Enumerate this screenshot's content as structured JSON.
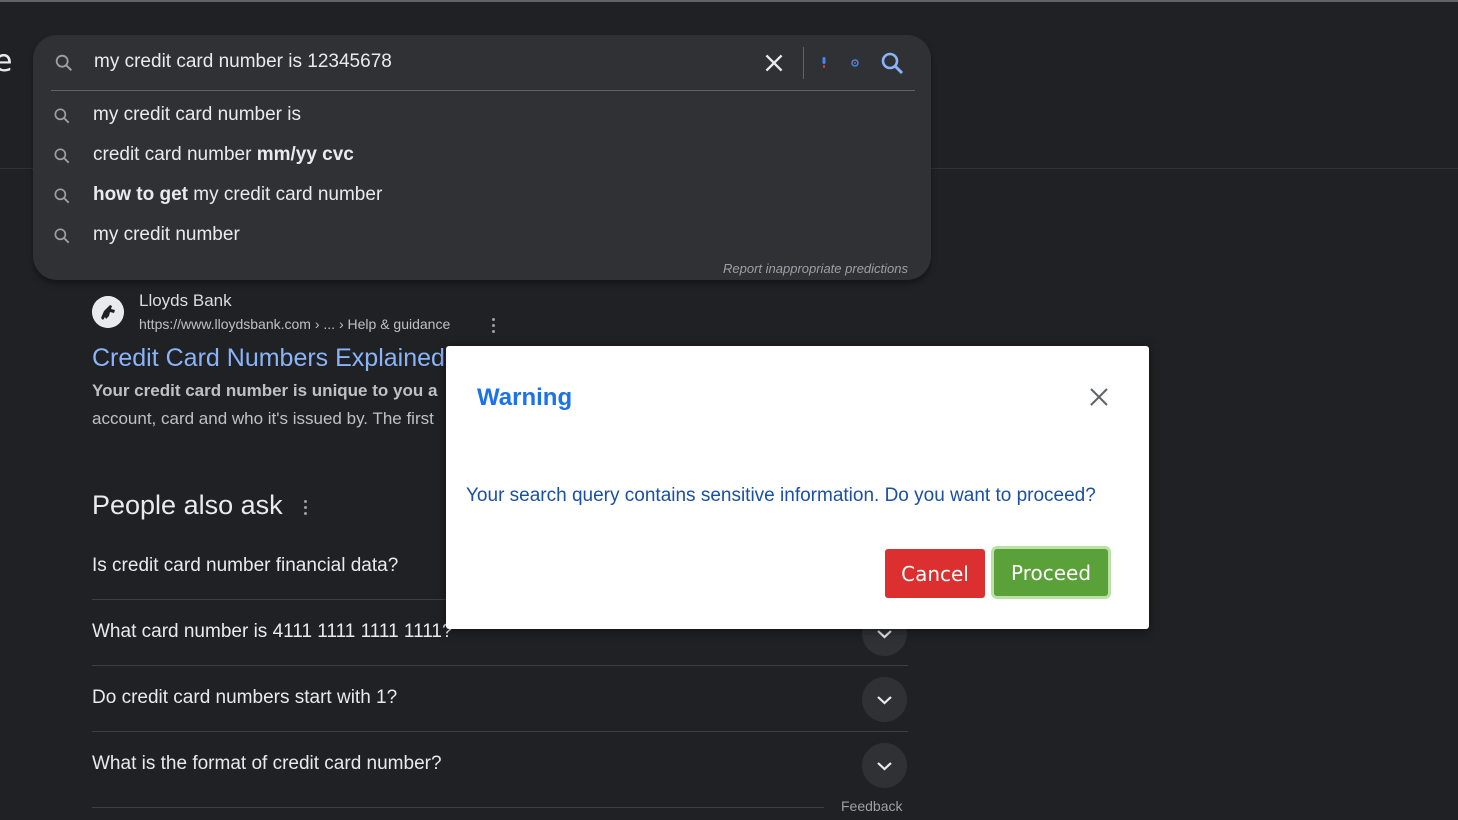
{
  "header": {
    "logo_fragment": "e"
  },
  "search": {
    "query": "my credit card number is 12345678",
    "suggestions": [
      {
        "parts": [
          {
            "text": "my credit card number is",
            "bold": false
          }
        ]
      },
      {
        "parts": [
          {
            "text": "credit card number ",
            "bold": false
          },
          {
            "text": "mm/yy cvc",
            "bold": true
          }
        ]
      },
      {
        "parts": [
          {
            "text": "how to get",
            "bold": true
          },
          {
            "text": " my credit card number",
            "bold": false
          }
        ]
      },
      {
        "parts": [
          {
            "text": "my credit number",
            "bold": false
          }
        ]
      }
    ],
    "report_link": "Report inappropriate predictions"
  },
  "result": {
    "site_name": "Lloyds Bank",
    "url": "https://www.lloydsbank.com › ... › Help & guidance",
    "title": "Credit Card Numbers Explained",
    "snippet_line1": "Your credit card number is unique to you a",
    "snippet_line2": "account, card and who it's issued by. The first"
  },
  "paa": {
    "heading": "People also ask",
    "questions": [
      "Is credit card number financial data?",
      "What card number is 4111 1111 1111 1111?",
      "Do credit card numbers start with 1?",
      "What is the format of credit card number?"
    ],
    "feedback": "Feedback"
  },
  "modal": {
    "title": "Warning",
    "message": "Your search query contains sensitive information. Do you want to proceed?",
    "cancel_label": "Cancel",
    "proceed_label": "Proceed"
  },
  "colors": {
    "page_bg": "#202124",
    "surface": "#303134",
    "link_blue": "#8ab4f8",
    "modal_title": "#1a73e8",
    "cancel_red": "#dc3030",
    "proceed_green": "#5aa13a"
  }
}
